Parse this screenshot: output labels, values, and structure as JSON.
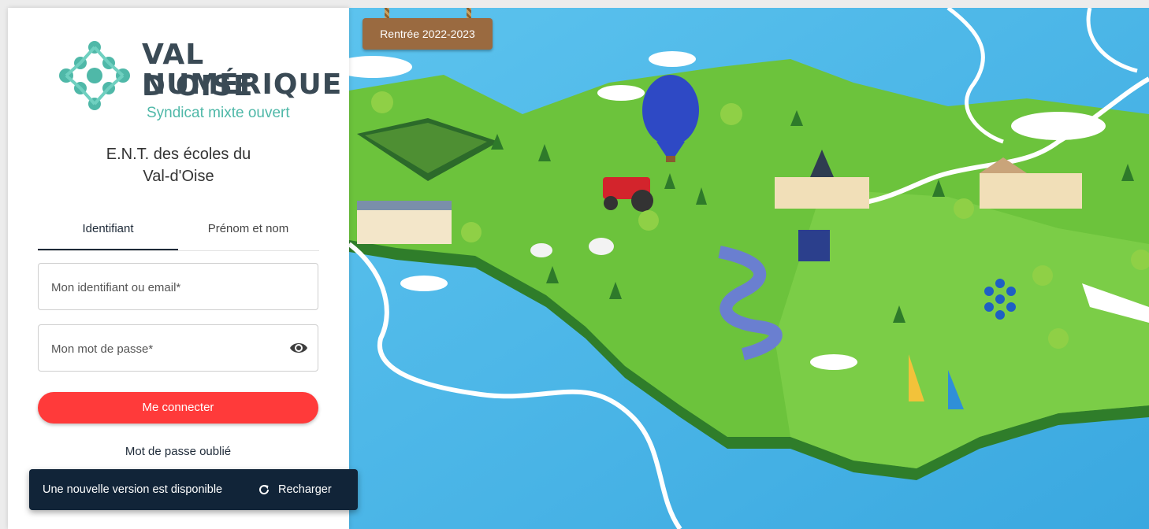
{
  "logo": {
    "line1": "VAL D'OISE",
    "line2": "NUMÉRIQUE",
    "line3": "Syndicat mixte ouvert"
  },
  "title": {
    "line1": "E.N.T. des écoles du",
    "line2": "Val-d'Oise"
  },
  "tabs": [
    {
      "label": "Identifiant",
      "active": true
    },
    {
      "label": "Prénom et nom",
      "active": false
    }
  ],
  "form": {
    "identifier_placeholder": "Mon identifiant ou email*",
    "password_placeholder": "Mon mot de passe*",
    "submit_label": "Me connecter",
    "forgot_label": "Mot de passe oublié"
  },
  "snackbar": {
    "message": "Une nouvelle version est disponible",
    "action_label": "Recharger"
  },
  "badge": {
    "label": "Rentrée 2022-2023"
  },
  "colors": {
    "accent_red": "#ff3a3a",
    "teal": "#4fb8a8",
    "navy": "#112438",
    "badge_brown": "#9a6a40"
  }
}
